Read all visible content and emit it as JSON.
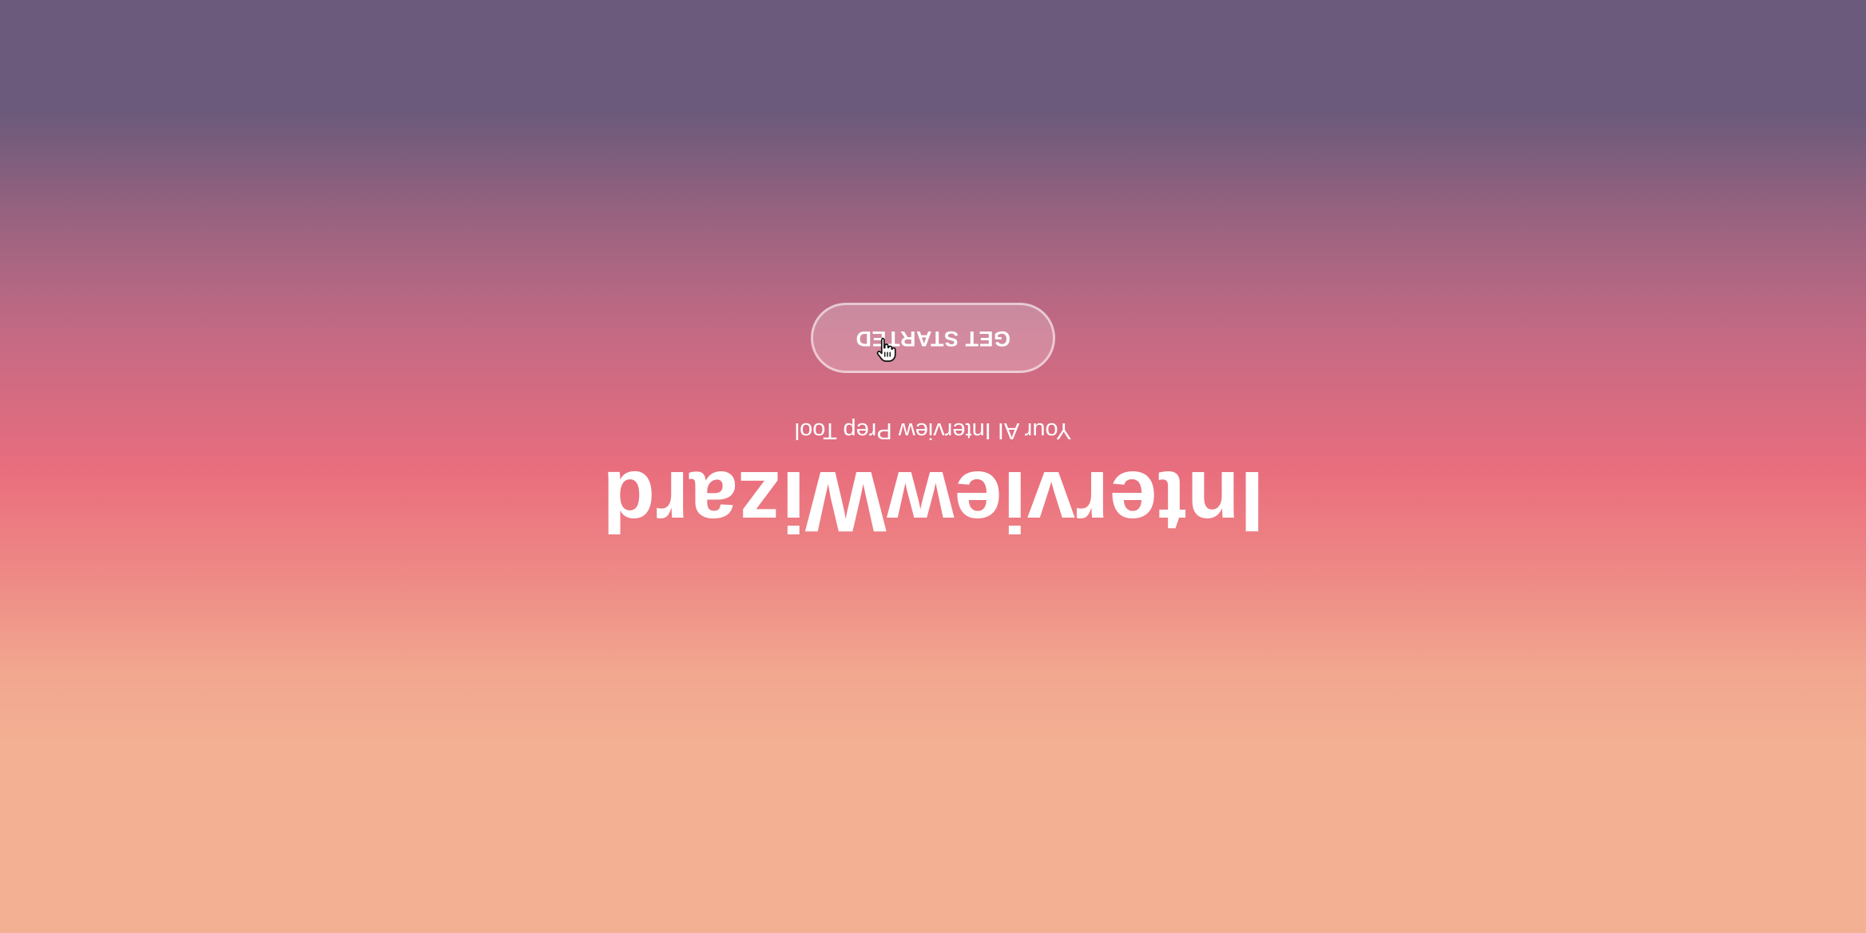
{
  "hero": {
    "title": "InterviewWizard",
    "subtitle": "Your AI Interview Prep Tool",
    "cta_label": "GET STARTED"
  },
  "icons": {
    "cursor": "hand-pointer-cursor-icon"
  },
  "colors": {
    "gradient_top": "#6b5a7b",
    "gradient_mid": "#ea6f7e",
    "gradient_bottom": "#f3b093",
    "text": "#ffffff"
  }
}
